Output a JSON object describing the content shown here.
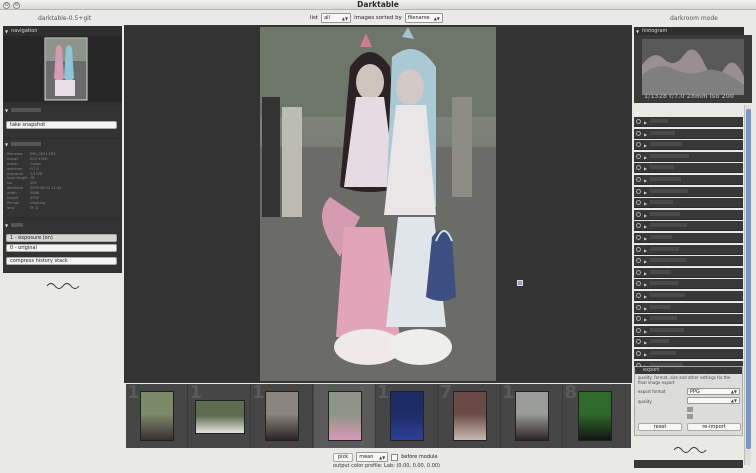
{
  "window": {
    "title": "Darktable",
    "left_title": "darktable-0.5+git",
    "right_title": "darkroom mode"
  },
  "topbar": {
    "list_label": "list",
    "list_value": "all",
    "sort_label": "images sorted by",
    "sort_value": "filename"
  },
  "left": {
    "navigation": "navigation",
    "snapshots": "snapshots",
    "take_snapshot": "take snapshot",
    "metadata": "metadata",
    "metadata_lines": [
      {
        "k": "filename",
        "v": "IMG_0001.CR2"
      },
      {
        "k": "model",
        "v": "EOS 400D"
      },
      {
        "k": "maker",
        "v": "Canon"
      },
      {
        "k": "aperture",
        "v": "F/7.0"
      },
      {
        "k": "exposure",
        "v": "1/1328"
      },
      {
        "k": "focal length",
        "v": "28"
      },
      {
        "k": "iso",
        "v": "200"
      },
      {
        "k": "datetime",
        "v": "2009:06:22 11:44"
      },
      {
        "k": "width",
        "v": "3888"
      },
      {
        "k": "height",
        "v": "2592"
      },
      {
        "k": "filmroll",
        "v": "shooting"
      },
      {
        "k": "lens",
        "v": "EF-S"
      }
    ],
    "history": "history",
    "history_items": [
      "1 - exposure (on)",
      "0 - original"
    ],
    "compress_history": "compress history stack"
  },
  "right": {
    "histogram": "histogram",
    "exif_line": "1/1328 f/7.0 28mm iso 200",
    "export": "export",
    "export_info": "quality, format, size and other settings for the final image export",
    "format_label": "export format",
    "format_value": "PPG",
    "quality_label": "quality",
    "reset": "reset",
    "reimport": "re-import"
  },
  "bottom": {
    "pick": "pick",
    "mode": "mean",
    "position": "before module",
    "color_info": "output color profile: Lab: (0.00, 0.00, 0.00)"
  },
  "filmstrip": {
    "numbers": [
      "1",
      "1",
      "1",
      "5",
      "1",
      "7",
      "1",
      "8"
    ]
  },
  "colors": {
    "accent": "#7a95c7",
    "panel_dark": "#2f2f2f",
    "chrome": "#e9e9e6"
  }
}
